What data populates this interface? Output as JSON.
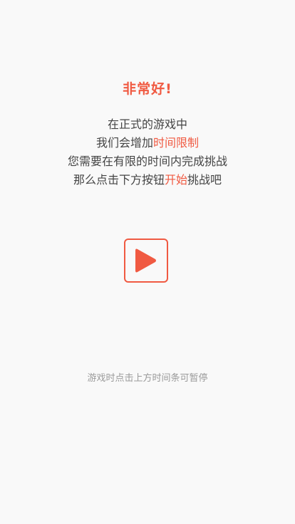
{
  "header": {
    "title": "非常好!"
  },
  "instructions": {
    "line1": "在正式的游戏中",
    "line2_prefix": "我们会增加",
    "line2_highlight": "时间限制",
    "line3": "您需要在有限的时间内完成挑战",
    "line4_prefix": "那么点击下方按钮",
    "line4_highlight": "开始",
    "line4_suffix": "挑战吧"
  },
  "play_button": {
    "icon": "play-icon"
  },
  "hint": {
    "text": "游戏时点击上方时间条可暂停"
  },
  "colors": {
    "accent": "#f05a42",
    "text": "#444444",
    "muted": "#9a9a9a",
    "background": "#f9f9f9"
  }
}
